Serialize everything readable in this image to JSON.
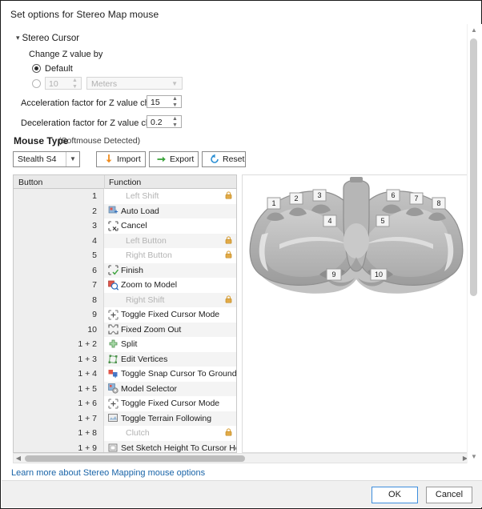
{
  "dialog": {
    "title": "Set options for Stereo Map mouse"
  },
  "section": {
    "header": "Stereo Cursor",
    "change_z_label": "Change Z value by",
    "default_label": "Default",
    "custom_value": "10",
    "unit_value": "Meters",
    "accel_label": "Acceleration factor for Z value change",
    "accel_value": "15",
    "decel_label": "Deceleration factor for Z value change",
    "decel_value": "0.2"
  },
  "mouse_type": {
    "label": "Mouse Type",
    "detected": "(Softmouse Detected)",
    "selected_device": "Stealth S4",
    "import_label": "Import",
    "export_label": "Export",
    "reset_label": "Reset"
  },
  "table": {
    "columns": [
      "Button",
      "Function"
    ],
    "rows": [
      {
        "button": "1",
        "function": "Left Shift",
        "locked": true,
        "icon": ""
      },
      {
        "button": "2",
        "function": "Auto Load",
        "locked": false,
        "icon": "auto-load-icon"
      },
      {
        "button": "3",
        "function": "Cancel",
        "locked": false,
        "icon": "cancel-icon"
      },
      {
        "button": "4",
        "function": "Left Button",
        "locked": true,
        "icon": ""
      },
      {
        "button": "5",
        "function": "Right Button",
        "locked": true,
        "icon": ""
      },
      {
        "button": "6",
        "function": "Finish",
        "locked": false,
        "icon": "finish-icon"
      },
      {
        "button": "7",
        "function": "Zoom to Model",
        "locked": false,
        "icon": "zoom-to-model-icon"
      },
      {
        "button": "8",
        "function": "Right Shift",
        "locked": true,
        "icon": ""
      },
      {
        "button": "9",
        "function": "Toggle Fixed Cursor Mode",
        "locked": false,
        "icon": "fixed-cursor-icon"
      },
      {
        "button": "10",
        "function": "Fixed Zoom Out",
        "locked": false,
        "icon": "fixed-zoom-out-icon"
      },
      {
        "button": "1 + 2",
        "function": "Split",
        "locked": false,
        "icon": "split-icon"
      },
      {
        "button": "1 + 3",
        "function": "Edit Vertices",
        "locked": false,
        "icon": "edit-vertices-icon"
      },
      {
        "button": "1 + 4",
        "function": "Toggle Snap Cursor To Ground",
        "locked": false,
        "icon": "snap-ground-icon"
      },
      {
        "button": "1 + 5",
        "function": "Model Selector",
        "locked": false,
        "icon": "model-selector-icon"
      },
      {
        "button": "1 + 6",
        "function": "Toggle Fixed Cursor Mode",
        "locked": false,
        "icon": "fixed-cursor-icon"
      },
      {
        "button": "1 + 7",
        "function": "Toggle Terrain Following",
        "locked": false,
        "icon": "terrain-following-icon"
      },
      {
        "button": "1 + 8",
        "function": "Clutch",
        "locked": true,
        "icon": ""
      },
      {
        "button": "1 + 9",
        "function": "Set Sketch Height To Cursor Height",
        "locked": false,
        "icon": "sketch-height-icon"
      }
    ]
  },
  "diagram": {
    "callouts": [
      "1",
      "2",
      "3",
      "4",
      "5",
      "6",
      "7",
      "8",
      "9",
      "10"
    ]
  },
  "footer": {
    "link": "Learn more about Stereo Mapping mouse options",
    "ok_label": "OK",
    "cancel_label": "Cancel"
  },
  "colors": {
    "link": "#1964a8",
    "accent": "#3d8ddd",
    "lock": "#d89b2c",
    "import_arrow": "#f08c1e",
    "export_arrow": "#3ba33b",
    "reset_arrow": "#2a8fd4"
  }
}
